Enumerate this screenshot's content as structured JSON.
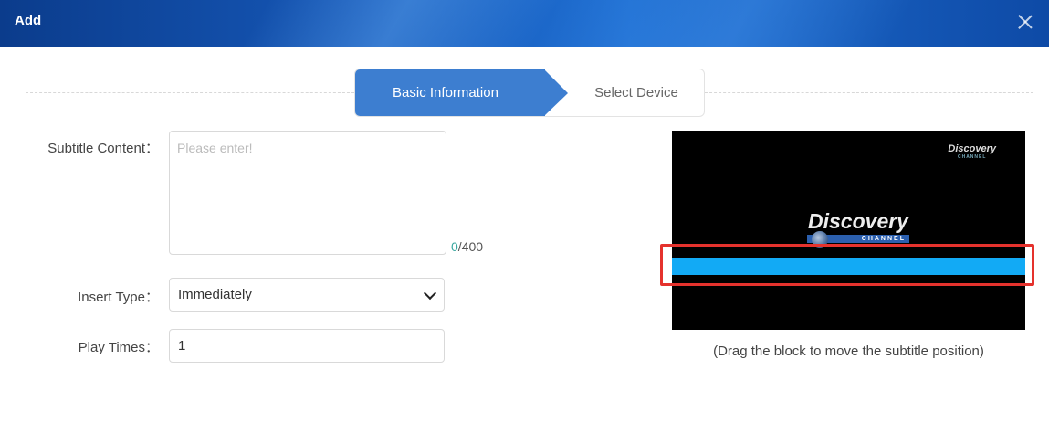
{
  "dialog": {
    "title": "Add"
  },
  "steps": {
    "active": "Basic Information",
    "next": "Select Device"
  },
  "form": {
    "subtitle_content_label": "Subtitle Content：",
    "subtitle_content_placeholder": "Please enter!",
    "subtitle_content_value": "",
    "counter_current": "0",
    "counter_max": "/400",
    "insert_type_label": "Insert Type：",
    "insert_type_value": "Immediately",
    "play_times_label": "Play Times：",
    "play_times_value": "1"
  },
  "preview": {
    "logo_small_brand": "Discovery",
    "logo_small_sub": "CHANNEL",
    "logo_main_brand": "Discovery",
    "logo_main_sub": "CHANNEL",
    "hint": "(Drag the block to move the subtitle position)"
  },
  "colors": {
    "step_active": "#3d7ed0",
    "subtitle_bar": "#12aaf5",
    "highlight_box": "#e5322d",
    "counter_zero": "#3aa7a0"
  }
}
